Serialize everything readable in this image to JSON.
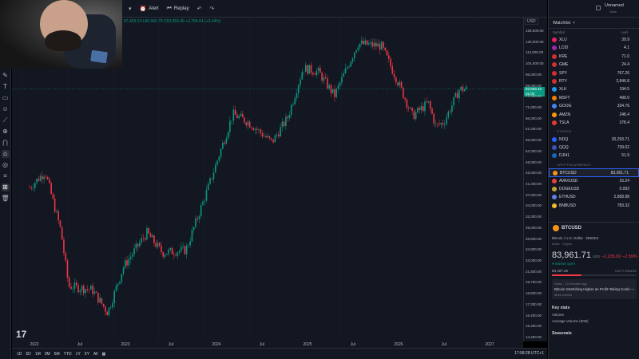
{
  "toolbar": {
    "alert_label": "Alert",
    "replay_label": "Replay"
  },
  "chart": {
    "ohlc_text": "97,403.24 L80,943.70 C83,959.46 +2,784.64 (+3.44%)",
    "currency": "USD",
    "current_price": "83,959.46",
    "current_countdown": "01:00",
    "price_axis": [
      "128,000.00",
      "120,000.00",
      "112,000.00",
      "104,000.00",
      "96,000.00",
      "88,000.00",
      "77,000.00",
      "71,000.00",
      "66,000.00",
      "61,000.00",
      "56,000.00",
      "52,000.00",
      "48,000.00",
      "45,000.00",
      "41,000.00",
      "37,000.00",
      "34,000.00",
      "32,000.00",
      "29,000.00",
      "26,600.00",
      "24,800.00",
      "23,000.00",
      "21,500.00",
      "19,700.00",
      "18,500.00",
      "17,300.00",
      "16,400.00",
      "15,400.00",
      "14,400.00"
    ],
    "time_axis": [
      "2022",
      "Jul",
      "2023",
      "Jul",
      "2024",
      "Jul",
      "2025",
      "Jul",
      "2026",
      "Jul",
      "2027"
    ],
    "up_color": "#089981",
    "down_color": "#f23645"
  },
  "chart_data": {
    "type": "candlestick",
    "symbol": "BTCUSD",
    "interval": "1W",
    "scale": "log",
    "x_start": "2022-01",
    "x_end": "2026-09",
    "ylim": [
      14000,
      135000
    ],
    "anchors": [
      {
        "date": "2022-01",
        "close": 41000
      },
      {
        "date": "2022-03",
        "close": 46000
      },
      {
        "date": "2022-05",
        "close": 30000
      },
      {
        "date": "2022-06",
        "close": 20000
      },
      {
        "date": "2022-09",
        "close": 19500
      },
      {
        "date": "2022-11",
        "close": 16500
      },
      {
        "date": "2023-01",
        "close": 23000
      },
      {
        "date": "2023-04",
        "close": 29500
      },
      {
        "date": "2023-06",
        "close": 25500
      },
      {
        "date": "2023-09",
        "close": 26000
      },
      {
        "date": "2023-12",
        "close": 42000
      },
      {
        "date": "2024-03",
        "close": 70000
      },
      {
        "date": "2024-05",
        "close": 66000
      },
      {
        "date": "2024-08",
        "close": 57000
      },
      {
        "date": "2024-10",
        "close": 68000
      },
      {
        "date": "2024-12",
        "close": 98000
      },
      {
        "date": "2025-02",
        "close": 95000
      },
      {
        "date": "2025-04",
        "close": 80000
      },
      {
        "date": "2025-07",
        "close": 117000
      },
      {
        "date": "2025-10",
        "close": 115000
      },
      {
        "date": "2025-12",
        "close": 90000
      },
      {
        "date": "2026-02",
        "close": 69000
      },
      {
        "date": "2026-04",
        "close": 76000
      },
      {
        "date": "2026-05",
        "close": 64000
      },
      {
        "date": "2026-06",
        "close": 66000
      },
      {
        "date": "2026-08",
        "close": 83959
      }
    ]
  },
  "bottom": {
    "timeframes": [
      "1D",
      "5D",
      "1M",
      "3M",
      "6M",
      "YTD",
      "1Y",
      "5Y",
      "All"
    ],
    "clock": "17:58:28 UTC+1"
  },
  "layout": {
    "name": "Unnamed",
    "sub": "Save"
  },
  "watchlist": {
    "title": "Watchlist",
    "col_symbol": "Symbol",
    "col_last": "Last",
    "items": [
      {
        "symbol": "XLU",
        "last": "39.9",
        "color": "#e91e63"
      },
      {
        "symbol": "LCID",
        "last": "4.1",
        "color": "#9c27b0"
      },
      {
        "symbol": "KRE",
        "last": "71.0",
        "color": "#d32f2f"
      },
      {
        "symbol": "GME",
        "last": "24.4",
        "color": "#d32f2f"
      },
      {
        "symbol": "SPY",
        "last": "767.26",
        "color": "#d32f2f"
      },
      {
        "symbol": "RTY",
        "last": "2,846.8",
        "color": "#d32f2f"
      },
      {
        "symbol": "XLK",
        "last": "194.5",
        "color": "#2196f3"
      },
      {
        "symbol": "MSFT",
        "last": "499.0",
        "color": "#f57c00"
      },
      {
        "symbol": "GOOG",
        "last": "334.76",
        "color": "#4285f4"
      },
      {
        "symbol": "AMZN",
        "last": "248.4",
        "color": "#ff9800"
      },
      {
        "symbol": "TSLA",
        "last": "378.4",
        "color": "#e53935"
      }
    ],
    "section_stocks": "STOCKS",
    "stocks": [
      {
        "symbol": "NDQ",
        "last": "30,293.71",
        "color": "#2962ff"
      },
      {
        "symbol": "QQQ",
        "last": "739.02",
        "color": "#3f51b5"
      },
      {
        "symbol": "DJI41",
        "last": "51.9",
        "color": "#1565c0"
      }
    ],
    "section_crypto": "CRYPTOCURRENCY",
    "crypto": [
      {
        "symbol": "BTCUSD",
        "last": "83,961.71",
        "color": "#f7931a"
      },
      {
        "symbol": "AVAXUSD",
        "last": "16.24",
        "color": "#e84142"
      },
      {
        "symbol": "DOGEUSD",
        "last": "0.092",
        "color": "#c2a633"
      },
      {
        "symbol": "ETHUSD",
        "last": "2,858.98",
        "color": "#627eea"
      },
      {
        "symbol": "BNBUSD",
        "last": "783.32",
        "color": "#f3ba2f"
      }
    ]
  },
  "details": {
    "symbol": "BTCUSD",
    "name": "Bitcoin / U.S. Dollar · BNDEX",
    "category": "Index · Crypto",
    "price": "83,961.71",
    "currency": "USD",
    "change": "−2,235.82 −2.59%",
    "market_status": "● Market open",
    "day_low": "83,497.25",
    "range_label": "DAY'S RANGE",
    "range_fraction": 0.35,
    "news_meta": "News · 12 minutes ago",
    "news_title": "Bitcoin Stretching Higher as Profit-Taking Cools — M",
    "news_more": "More events",
    "key_stats": "Key stats",
    "stat_volume": "Volume",
    "stat_avg_volume": "Average Volume (30D)",
    "seasonals": "Seasonals"
  }
}
